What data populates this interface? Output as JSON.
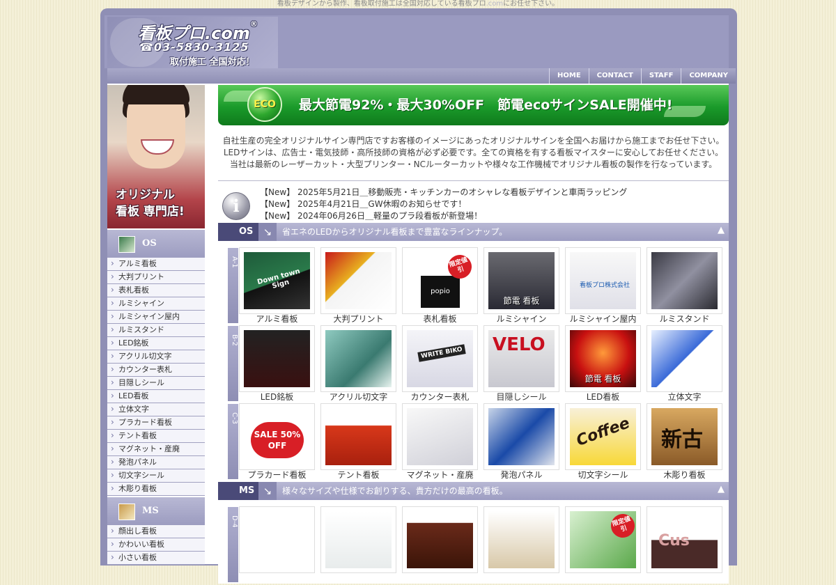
{
  "top_notice": {
    "before": "看板デザインから製作、看板取付施工は全国対応している看板プロ",
    "dim": ".com",
    "after": "にお任せ下さい。"
  },
  "logo": {
    "title": "看板プロ.com",
    "reg": "®",
    "tel": "☎03-5830-3125",
    "sub": "取付施工 全国対応！"
  },
  "nav": [
    "HOME",
    "CONTACT",
    "STAFF",
    "COMPANY"
  ],
  "hero": {
    "line1": "オリジナル",
    "line2": "看板 専門店!"
  },
  "sidebar": {
    "os_title": "OS",
    "os_items": [
      "アルミ看板",
      "大判プリント",
      "表札看板",
      "ルミシャイン",
      "ルミシャイン屋内",
      "ルミスタンド",
      "LED銘板",
      "アクリル切文字",
      "カウンター表札",
      "目隠しシール",
      "LED看板",
      "立体文字",
      "プラカード看板",
      "テント看板",
      "マグネット・産廃",
      "発泡パネル",
      "切文字シール",
      "木彫り看板"
    ],
    "ms_title": "MS",
    "ms_items": [
      "顔出し看板",
      "かわいい看板",
      "小さい看板"
    ]
  },
  "eco_banner": {
    "ball": "ECO",
    "text": "最大節電92%・最大30%OFF　節電ecoサインSALE開催中!"
  },
  "intro": [
    "自社生産の完全オリジナルサイン専門店ですお客様のイメージにあったオリジナルサインを全国へお届けから施工までお任せ下さい。",
    "LEDサインは、広告士・電気技師・高所技師の資格が必ず必要です。全ての資格を有する看板マイスターに安心してお任せください。",
    "当社は最新のレーザーカット・大型プリンター・NCルーターカットや様々な工作機械でオリジナル看板の製作を行なっています。"
  ],
  "news": [
    "【New】 2025年5月21日＿移動販売・キッチンカーのオシャレな看板デザインと車両ラッピング",
    "【New】 2025年4月21日＿GW休暇のお知らせです！",
    "【New】 2024年06月26日＿軽量のプラ段看板が新登場！"
  ],
  "categories": [
    {
      "tag": "OS",
      "desc": "省エネのLEDからオリジナル看板まで豊富なラインナップ。",
      "rows": [
        {
          "label": "A-1",
          "items": [
            "アルミ看板",
            "大判プリント",
            "表札看板",
            "ルミシャイン",
            "ルミシャイン屋内",
            "ルミスタンド"
          ]
        },
        {
          "label": "B-2",
          "items": [
            "LED銘板",
            "アクリル切文字",
            "カウンター表札",
            "目隠しシール",
            "LED看板",
            "立体文字"
          ]
        },
        {
          "label": "C-3",
          "items": [
            "プラカード看板",
            "テント看板",
            "マグネット・産廃",
            "発泡パネル",
            "切文字シール",
            "木彫り看板"
          ]
        }
      ]
    },
    {
      "tag": "MS",
      "desc": "様々なサイズや仕様でお創りする、貴方だけの最高の看板。",
      "rows": [
        {
          "label": "D-4",
          "items": [
            "",
            "",
            "",
            "",
            "",
            ""
          ]
        }
      ]
    }
  ],
  "thumb_text": {
    "badge": "限定値引",
    "a1_4_caption": "節電 看板",
    "b2_5_caption": "節電 看板",
    "c3_1_sale": "SALE 50% OFF",
    "a1_3_sign": "popio",
    "a1_5_sign": "看板プロ株式会社",
    "b2_3_sign": "WRITE BIKO",
    "a1_1_sign": "Down town Sign",
    "c3_6_sign": "新古",
    "d4_6_sign": "Cus",
    "c3_5_sign": "Coffee",
    "b2_4_sign": "VELO"
  },
  "colors": {
    "frame": "#8f8fb5",
    "eco_green": "#1a9a2a",
    "cat_tag": "#4a4a78",
    "badge_red": "#d81f26"
  }
}
